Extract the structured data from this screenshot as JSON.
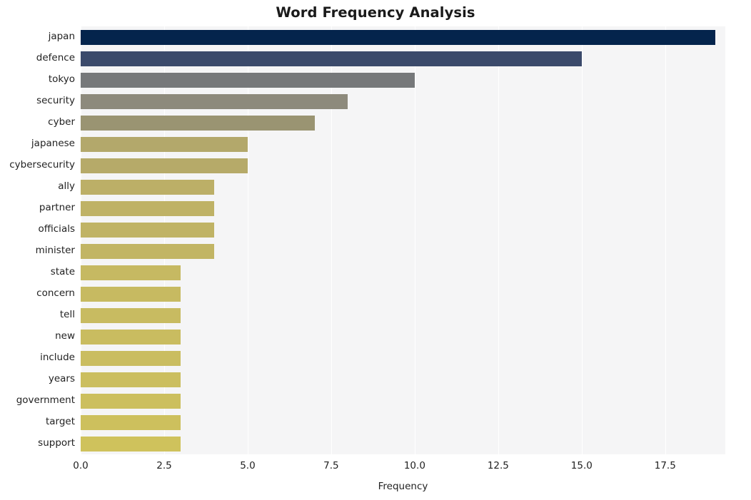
{
  "chart_data": {
    "type": "bar",
    "orientation": "horizontal",
    "title": "Word Frequency Analysis",
    "xlabel": "Frequency",
    "ylabel": "",
    "categories": [
      "japan",
      "defence",
      "tokyo",
      "security",
      "cyber",
      "japanese",
      "cybersecurity",
      "ally",
      "partner",
      "officials",
      "minister",
      "state",
      "concern",
      "tell",
      "new",
      "include",
      "years",
      "government",
      "target",
      "support"
    ],
    "values": [
      19,
      15,
      10,
      8,
      7,
      5,
      5,
      4,
      4,
      4,
      4,
      3,
      3,
      3,
      3,
      3,
      3,
      3,
      3,
      3
    ],
    "bar_colors": [
      "#04244c",
      "#3b4a6b",
      "#76787a",
      "#8d8a7c",
      "#9a9472",
      "#b3a86b",
      "#b6aa69",
      "#bcaf67",
      "#bfb266",
      "#c0b365",
      "#c2b564",
      "#c6b962",
      "#c7ba61",
      "#c8bb61",
      "#c9bc60",
      "#cabd60",
      "#cbbe5f",
      "#ccbf5e",
      "#cdc05d",
      "#cfc25c"
    ],
    "xticks": [
      "0.0",
      "2.5",
      "5.0",
      "7.5",
      "10.0",
      "12.5",
      "15.0",
      "17.5"
    ],
    "xtick_values": [
      0,
      2.5,
      5,
      7.5,
      10,
      12.5,
      15,
      17.5
    ],
    "xlim": [
      0,
      19.3
    ],
    "grid": true,
    "grid_color": "#ffffff",
    "plot_background": "#f5f5f6",
    "figure_background": "#ffffff",
    "legend": null
  }
}
